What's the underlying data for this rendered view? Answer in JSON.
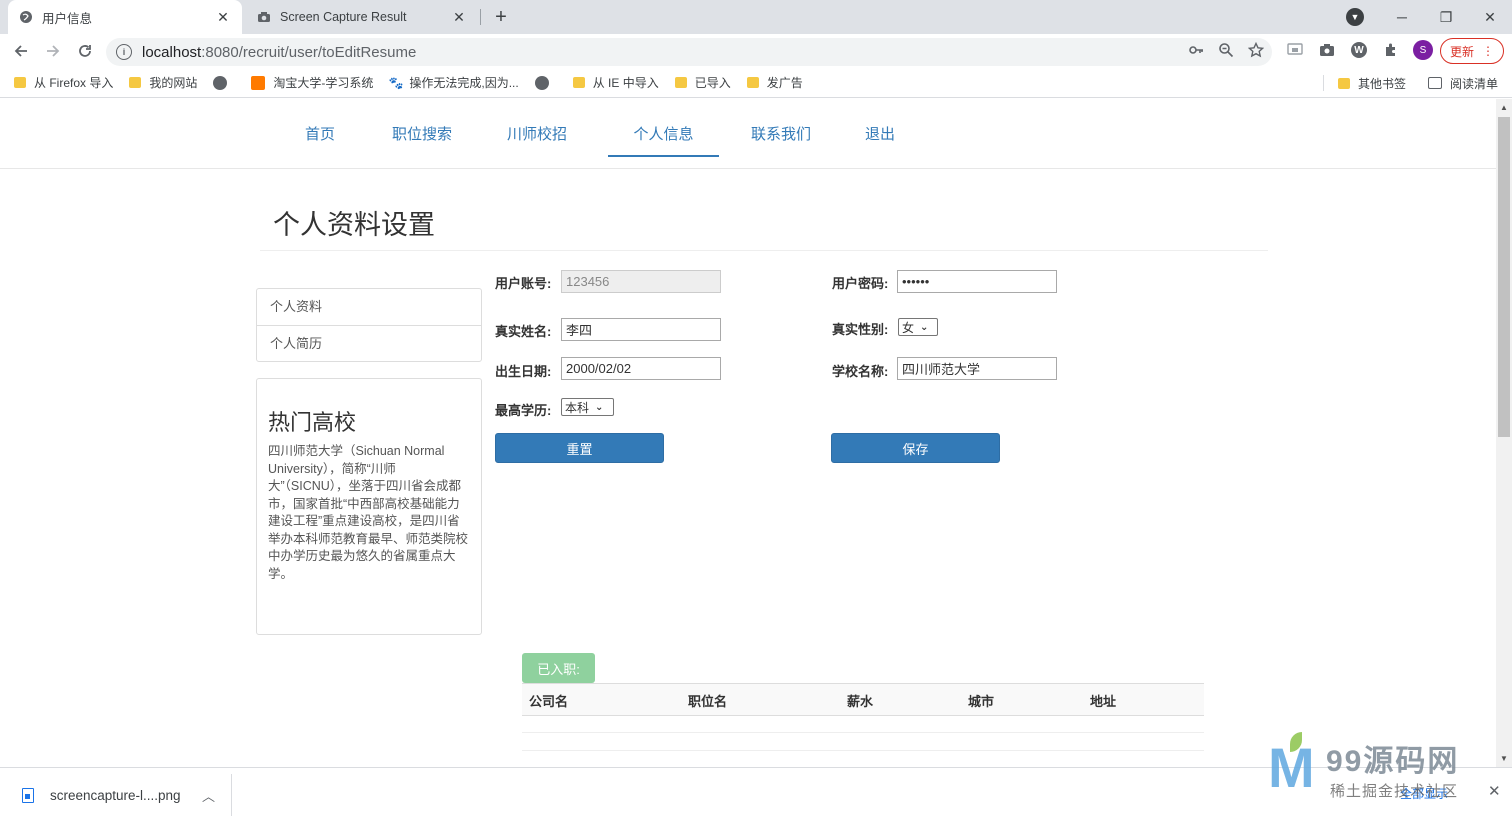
{
  "browser": {
    "tabs": [
      {
        "title": "用户信息",
        "active": true
      },
      {
        "title": "Screen Capture Result",
        "active": false
      }
    ],
    "url_host": "localhost",
    "url_rest": ":8080/recruit/user/toEditResume",
    "update_label": "更新",
    "avatar_letter": "S",
    "w_ext": "W",
    "bookmarks": [
      "从 Firefox 导入",
      "我的网站",
      "",
      "淘宝大学-学习系统",
      "操作无法完成,因为...",
      "",
      "从 IE 中导入",
      "已导入",
      "发广告"
    ],
    "bookmarks_right": [
      "其他书签",
      "阅读清单"
    ]
  },
  "site_nav": {
    "items": [
      "首页",
      "职位搜索",
      "川师校招",
      "个人信息",
      "联系我们",
      "退出"
    ],
    "active": "个人信息"
  },
  "page": {
    "title": "个人资料设置"
  },
  "side_menu": {
    "items": [
      "个人资料",
      "个人简历"
    ]
  },
  "hot_schools": {
    "title": "热门高校",
    "text": "四川师范大学（Sichuan Normal University），简称“川师大”（SICNU），坐落于四川省会成都市，国家首批“中西部高校基础能力建设工程”重点建设高校，是四川省举办本科师范教育最早、师范类院校中办学历史最为悠久的省属重点大学。"
  },
  "form": {
    "account_label": "用户账号:",
    "account_value": "123456",
    "password_label": "用户密码:",
    "password_value": "••••••",
    "realname_label": "真实姓名:",
    "realname_value": "李四",
    "gender_label": "真实性别:",
    "gender_value": "女",
    "birth_label": "出生日期:",
    "birth_value": "2000/02/02",
    "school_label": "学校名称:",
    "school_value": "四川师范大学",
    "edu_label": "最高学历:",
    "edu_value": "本科",
    "reset_label": "重置",
    "save_label": "保存"
  },
  "jobs": {
    "badge": "已入职:",
    "headers": [
      "公司名",
      "职位名",
      "薪水",
      "城市",
      "地址"
    ]
  },
  "download": {
    "filename": "screencapture-l....png",
    "show_all": "全部显示"
  },
  "watermark": {
    "title": "99源码网",
    "sub": "稀土掘金技术社区"
  }
}
